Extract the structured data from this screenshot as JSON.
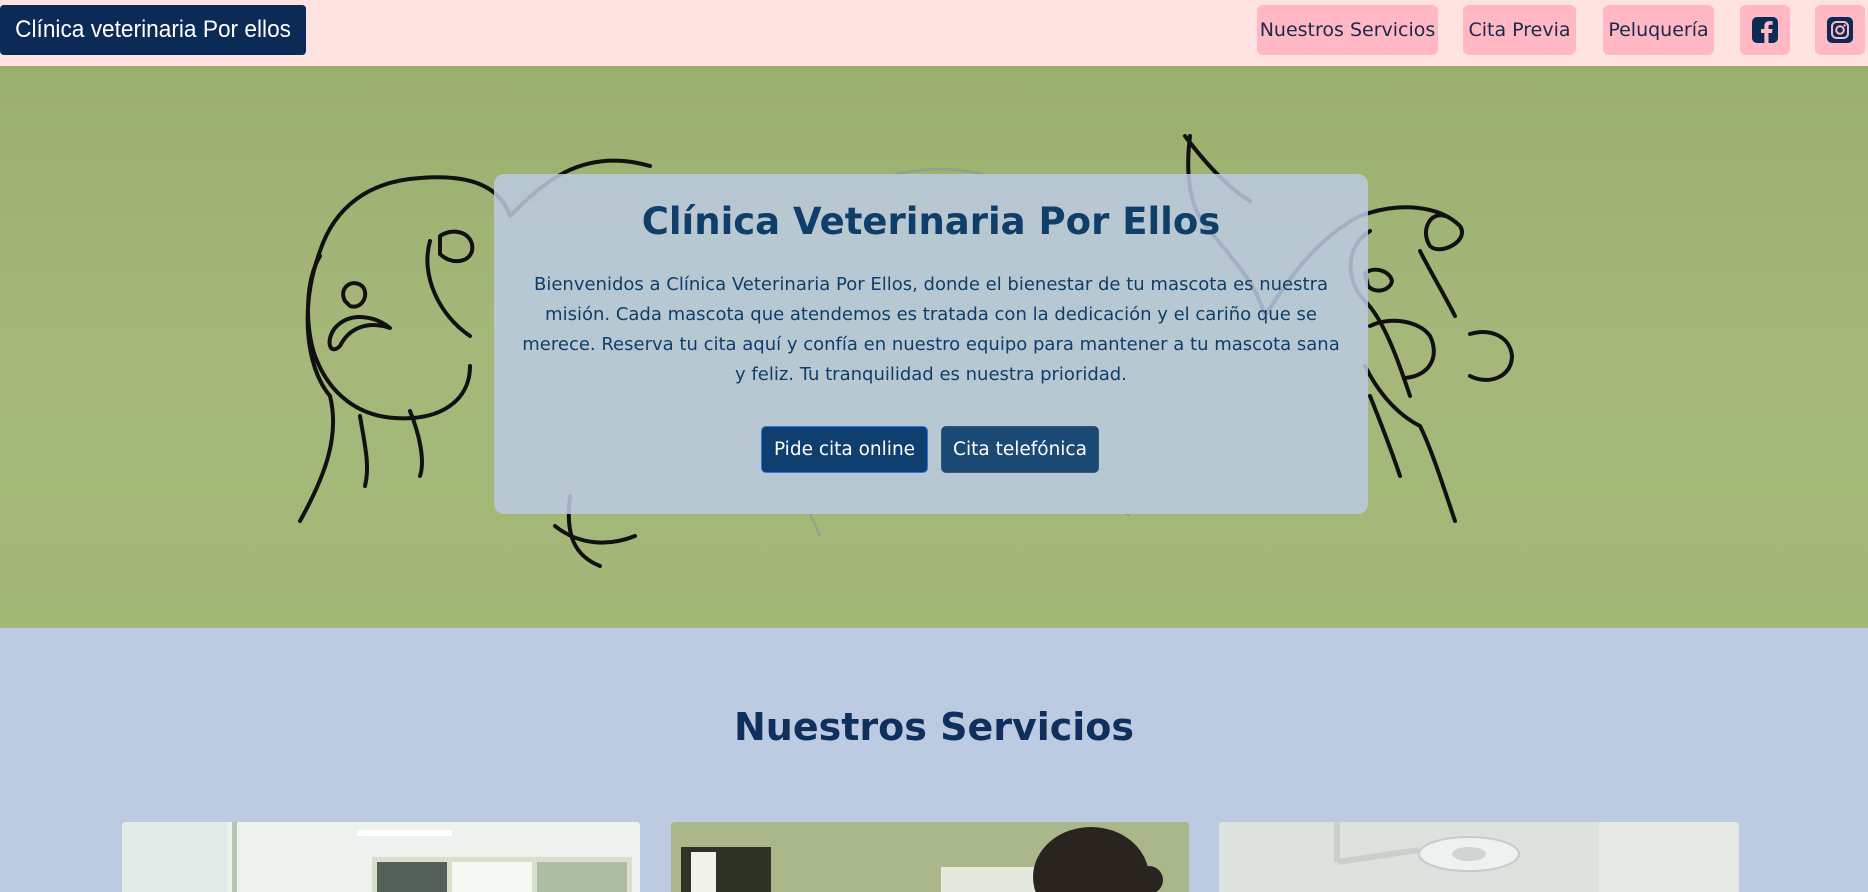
{
  "navbar": {
    "brand": "Clínica veterinaria Por ellos",
    "items": [
      {
        "label": "Nuestros Servicios"
      },
      {
        "label": "Cita Previa"
      },
      {
        "label": "Peluquería"
      }
    ],
    "social": [
      {
        "icon": "facebook-icon"
      },
      {
        "icon": "instagram-icon"
      }
    ]
  },
  "hero": {
    "title": "Clínica Veterinaria Por Ellos",
    "text": "Bienvenidos a Clínica Veterinaria Por Ellos, donde el bienestar de tu mascota es nuestra misión. Cada mascota que atendemos es tratada con la dedicación y el cariño que se merece. Reserva tu cita aquí y confía en nuestro equipo para mantener a tu mascota sana y feliz. Tu tranquilidad es nuestra prioridad.",
    "primary_cta": "Pide cita online",
    "secondary_cta": "Cita telefónica"
  },
  "services": {
    "title": "Nuestros Servicios"
  },
  "colors": {
    "navbar_bg": "#ffe2e2",
    "brand_bg": "#0b2a55",
    "nav_button_bg": "#ffb8c4",
    "hero_bg": "#a3b777",
    "section_bg": "#bccbe1",
    "accent": "#0f3e69"
  }
}
